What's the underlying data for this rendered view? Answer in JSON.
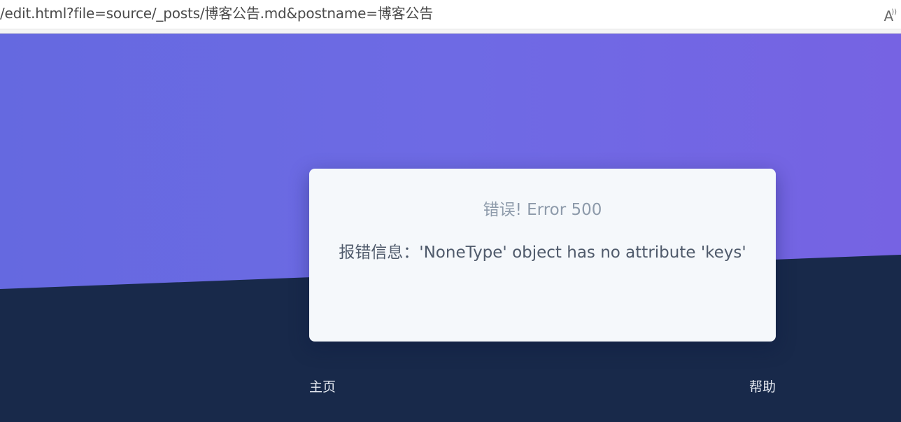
{
  "browser": {
    "url": "/edit.html?file=source/_posts/博客公告.md&postname=博客公告",
    "read_aloud_icon": "read-aloud-icon",
    "read_aloud_glyph": "A"
  },
  "error_card": {
    "title": "错误! Error 500",
    "message": "报错信息：'NoneType' object has no attribute 'keys'"
  },
  "footer": {
    "home_label": "主页",
    "help_label": "帮助"
  },
  "colors": {
    "hero_gradient_start": "#6569e0",
    "hero_gradient_end": "#7663e3",
    "dark_background": "#18294a",
    "card_background": "#f5f8fb"
  }
}
